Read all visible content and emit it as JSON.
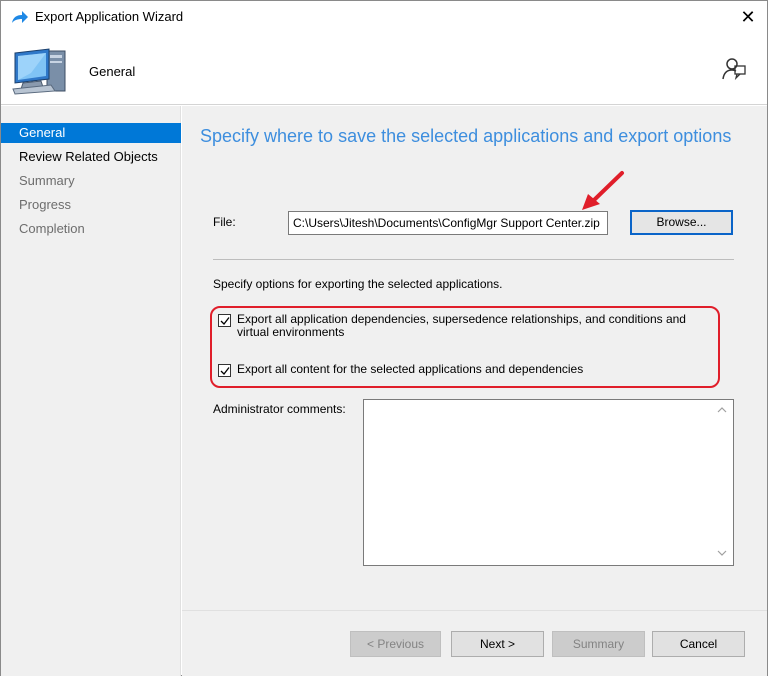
{
  "window": {
    "title": "Export Application Wizard",
    "close_glyph": "✕"
  },
  "header": {
    "title": "General"
  },
  "sidebar": {
    "items": [
      {
        "label": "General",
        "state": "active"
      },
      {
        "label": "Review Related Objects",
        "state": "enabled"
      },
      {
        "label": "Summary",
        "state": "disabled"
      },
      {
        "label": "Progress",
        "state": "disabled"
      },
      {
        "label": "Completion",
        "state": "disabled"
      }
    ]
  },
  "main": {
    "heading": "Specify where to save the selected applications and export options",
    "file": {
      "label": "File:",
      "value": "C:\\Users\\Jitesh\\Documents\\ConfigMgr Support Center.zip",
      "browse_label": "Browse..."
    },
    "options_text": "Specify options for exporting the selected applications.",
    "options": [
      {
        "label": "Export all application dependencies, supersedence relationships, and conditions and virtual environments",
        "checked": true
      },
      {
        "label": "Export all content for the selected applications and dependencies",
        "checked": true
      }
    ],
    "admin_comments": {
      "label": "Administrator comments:",
      "value": ""
    }
  },
  "footer": {
    "previous_label": "< Previous",
    "next_label": "Next >",
    "summary_label": "Summary",
    "cancel_label": "Cancel"
  },
  "colors": {
    "accent": "#0078d7",
    "heading": "#3d8ede",
    "annotation": "#e01e2a"
  },
  "icons": [
    "share-arrow-icon",
    "computer-icon",
    "feedback-icon",
    "checkmark-icon",
    "scroll-up-icon",
    "scroll-down-icon",
    "red-arrow-annotation"
  ]
}
